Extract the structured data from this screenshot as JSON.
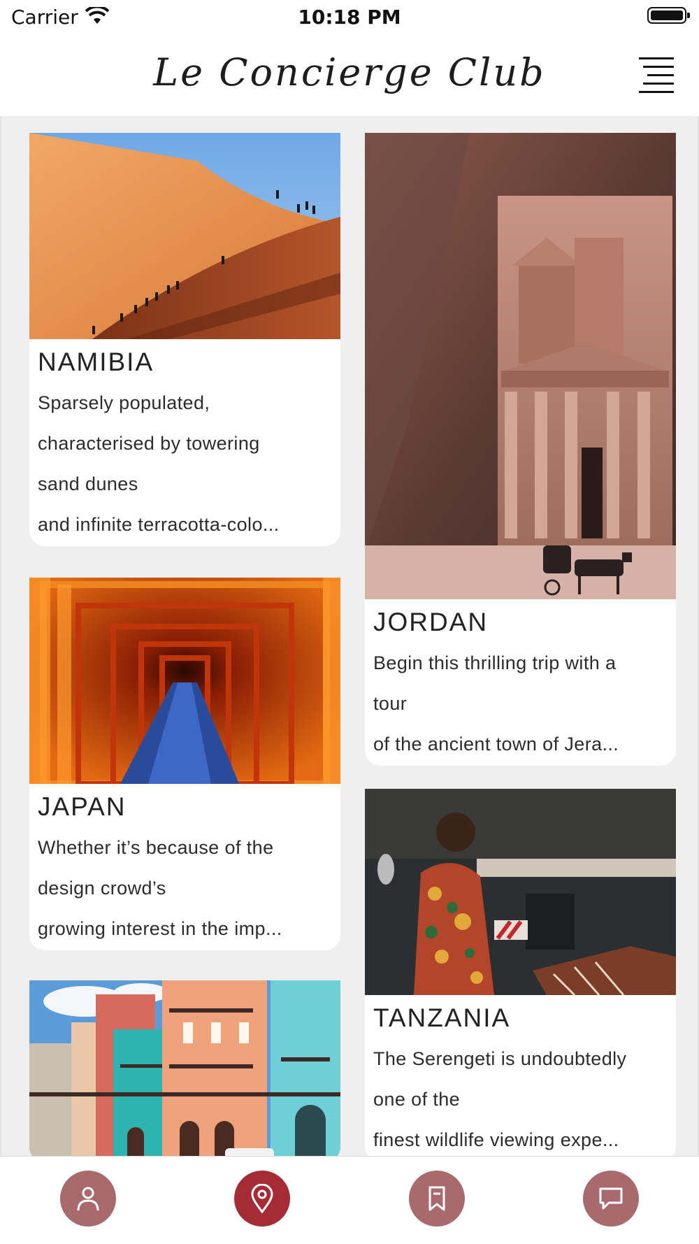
{
  "status_bar": {
    "carrier": "Carrier",
    "time": "10:18 PM"
  },
  "header": {
    "logo": "Le Concierge Club"
  },
  "destinations": [
    {
      "title": "NAMIBIA",
      "lines": [
        "Sparsely populated,",
        "characterised by towering",
        "sand dunes",
        "and infinite terracotta-colo..."
      ]
    },
    {
      "title": "JORDAN",
      "lines": [
        "Begin this thrilling trip with a",
        "tour",
        "of the ancient town of Jera..."
      ]
    },
    {
      "title": "JAPAN",
      "lines": [
        "Whether it’s because of the",
        "design crowd’s",
        "growing interest in the imp..."
      ]
    },
    {
      "title": "TANZANIA",
      "lines": [
        "The Serengeti is undoubtedly",
        "one of the",
        "finest wildlife viewing expe..."
      ]
    },
    {
      "title": "",
      "lines": []
    }
  ],
  "tabs": [
    {
      "icon": "profile-icon",
      "active": false
    },
    {
      "icon": "location-pin-icon",
      "active": true
    },
    {
      "icon": "bookmark-icon",
      "active": false
    },
    {
      "icon": "chat-icon",
      "active": false
    }
  ],
  "colors": {
    "tab_inactive": "#a86a6d",
    "tab_active": "#a52c35",
    "feed_bg": "#efefef"
  }
}
